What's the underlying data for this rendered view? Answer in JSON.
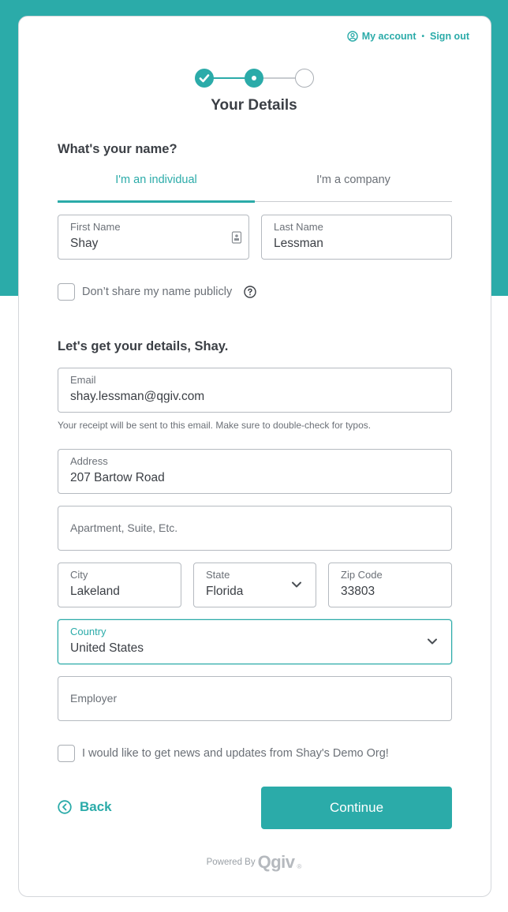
{
  "header": {
    "my_account": "My account",
    "separator": "•",
    "sign_out": "Sign out"
  },
  "stepper": {
    "steps": [
      "done",
      "current",
      "todo"
    ],
    "title": "Your Details"
  },
  "name_section": {
    "title": "What's your name?",
    "tabs": [
      {
        "label": "I'm an individual",
        "active": true
      },
      {
        "label": "I'm a company",
        "active": false
      }
    ],
    "first_name": {
      "label": "First Name",
      "value": "Shay"
    },
    "last_name": {
      "label": "Last Name",
      "value": "Lessman"
    },
    "hide_name_label": "Don’t share my name publicly"
  },
  "details_section": {
    "title": "Let's get your details, Shay.",
    "email": {
      "label": "Email",
      "value": "shay.lessman@qgiv.com"
    },
    "email_hint": "Your receipt will be sent to this email. Make sure to double-check for typos.",
    "address": {
      "label": "Address",
      "value": "207 Bartow Road"
    },
    "address2": {
      "placeholder": "Apartment, Suite, Etc."
    },
    "city": {
      "label": "City",
      "value": "Lakeland"
    },
    "state": {
      "label": "State",
      "value": "Florida"
    },
    "zip": {
      "label": "Zip Code",
      "value": "33803"
    },
    "country": {
      "label": "Country",
      "value": "United States"
    },
    "employer": {
      "placeholder": "Employer"
    },
    "newsletter_label": "I would like to get news and updates from Shay's Demo Org!"
  },
  "footer": {
    "back_label": "Back",
    "continue_label": "Continue",
    "powered_by": "Powered By",
    "logo_text": "Qgiv",
    "logo_mark": "®"
  },
  "colors": {
    "accent": "#2baba9",
    "text": "#3b3f45",
    "muted": "#6b7077",
    "border": "#b5bac0"
  },
  "icons": [
    "user-circle-icon",
    "check-icon",
    "contact-card-icon",
    "help-circle-icon",
    "chevron-down-icon",
    "chevron-left-circle-icon"
  ]
}
